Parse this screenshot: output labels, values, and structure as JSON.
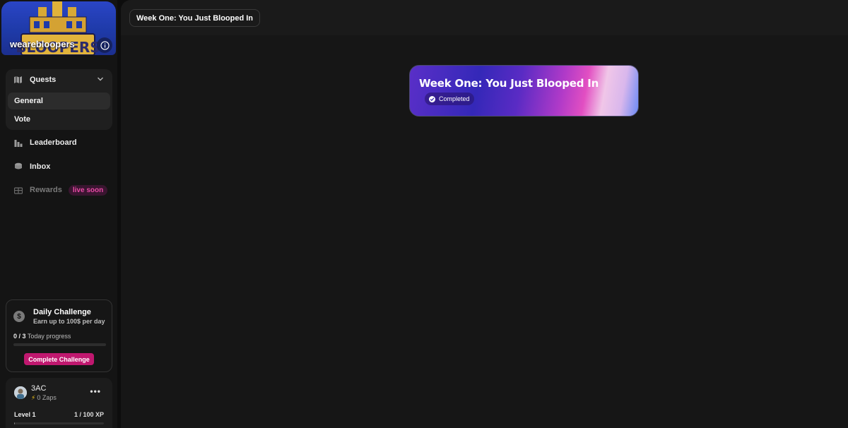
{
  "brand": {
    "name": "wearebloopers",
    "logo_text": "BLOOPERS"
  },
  "nav": {
    "quests_label": "Quests",
    "quest_sub_items": [
      "General",
      "Vote"
    ],
    "leaderboard_label": "Leaderboard",
    "inbox_label": "Inbox",
    "rewards_label": "Rewards",
    "rewards_badge": "live soon"
  },
  "daily_challenge": {
    "title": "Daily Challenge",
    "subtitle": "Earn up to 100$ per day",
    "progress_count": "0 / 3",
    "progress_label": "Today progress",
    "progress_fraction": 0,
    "button_label": "Complete Challenge",
    "coin_symbol": "$"
  },
  "user": {
    "name": "3AC",
    "zaps": "0 Zaps",
    "level": "Level 1",
    "xp": "1 / 100 XP",
    "xp_fraction": 0.01
  },
  "header": {
    "breadcrumb": "Week One: You Just Blooped In"
  },
  "quest_card": {
    "title": "Week One: You Just Blooped In",
    "status": "Completed"
  },
  "colors": {
    "accent_pink": "#c0186f",
    "brand_blue": "#2a45c6"
  }
}
